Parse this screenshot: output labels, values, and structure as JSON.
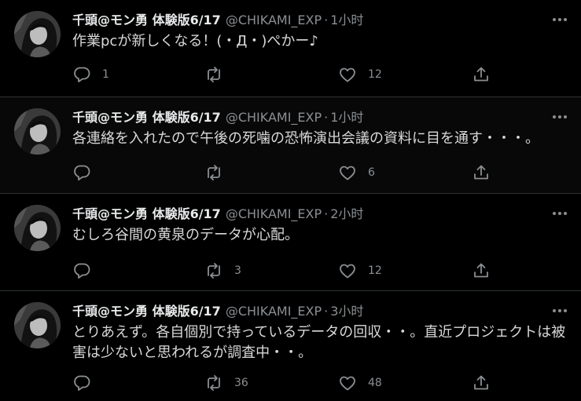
{
  "colors": {
    "background": "#000000",
    "text": "#d9d9d9",
    "secondary": "#8b8f93",
    "divider": "#2f3336"
  },
  "icons": {
    "reply": "reply-icon",
    "retweet": "retweet-icon",
    "like": "like-icon",
    "share": "share-icon",
    "more": "more-options-icon"
  },
  "tweets": [
    {
      "name": "千頭@モン勇 体験版6/17",
      "handle": "@CHIKAMI_EXP",
      "separator": "·",
      "time": "1小时",
      "text": "作業pcが新しくなる！(・Д・)ぺかー♪",
      "replies": "1",
      "retweets": "",
      "likes": "12"
    },
    {
      "name": "千頭@モン勇 体験版6/17",
      "handle": "@CHIKAMI_EXP",
      "separator": "·",
      "time": "1小时",
      "text": "各連絡を入れたので午後の死噛の恐怖演出会議の資料に目を通す・・・。",
      "replies": "",
      "retweets": "",
      "likes": "6"
    },
    {
      "name": "千頭@モン勇 体験版6/17",
      "handle": "@CHIKAMI_EXP",
      "separator": "·",
      "time": "2小时",
      "text": "むしろ谷間の黄泉のデータが心配。",
      "replies": "",
      "retweets": "3",
      "likes": "12"
    },
    {
      "name": "千頭@モン勇 体験版6/17",
      "handle": "@CHIKAMI_EXP",
      "separator": "·",
      "time": "3小时",
      "text": "とりあえず。各自個別で持っているデータの回収・・。直近プロジェクトは被害は少ないと思われるが調査中・・。",
      "replies": "",
      "retweets": "36",
      "likes": "48"
    }
  ]
}
